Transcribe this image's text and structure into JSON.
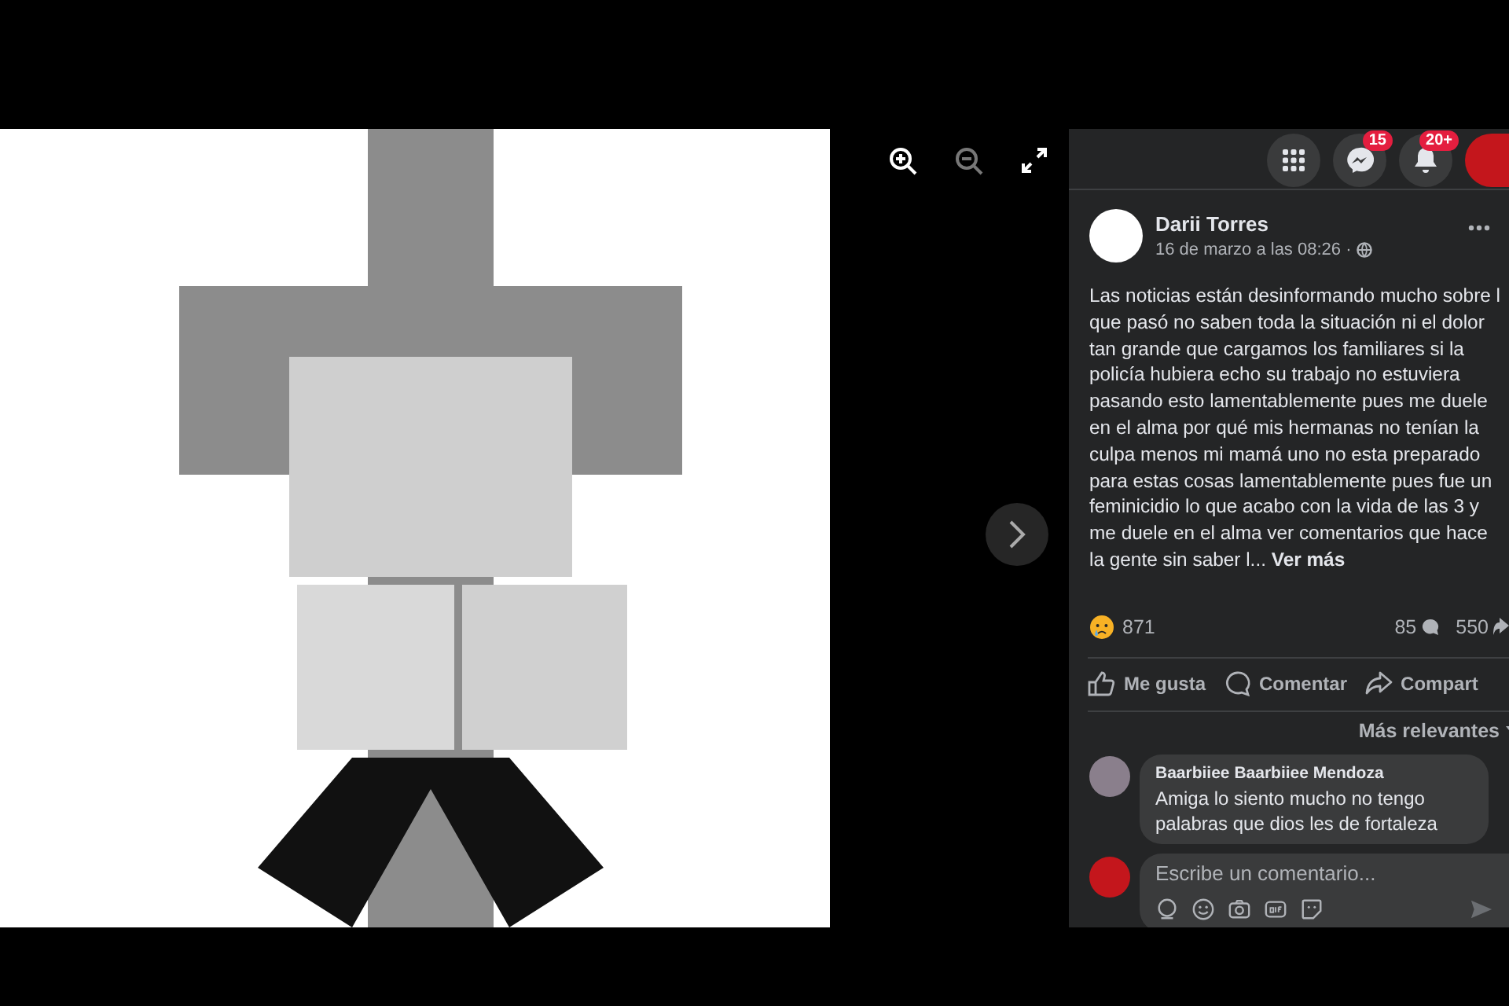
{
  "viewer": {
    "toolbar": [
      {
        "kind": "zoom-in",
        "disabled": false
      },
      {
        "kind": "zoom-out",
        "disabled": true
      },
      {
        "kind": "fullscreen",
        "disabled": false
      }
    ]
  },
  "top_nav": [
    {
      "kind": "menu"
    },
    {
      "kind": "messenger",
      "badge": "15"
    },
    {
      "kind": "notifications",
      "badge": "20+"
    },
    {
      "kind": "profile"
    }
  ],
  "post": {
    "author": "Darii Torres",
    "time": "16 de marzo a las 08:26 ·",
    "text": "Las noticias están desinformando mucho sobre l que pasó no saben toda la situación ni el dolor tan grande que cargamos los familiares si la policía hubiera echo su trabajo no estuviera pasando esto lamentablemente pues me duele en el alma por qué mis hermanas no tenían la culpa menos mi mamá uno no esta preparado para estas cosas lamentablemente pues fue un feminicidio lo que acabo con la vida de las 3 y me duele en el alma ver comentarios que hace la gente sin saber l...",
    "more": "Ver más",
    "reactions": "871",
    "comments_count": "85",
    "shares_count": "550"
  },
  "actions": [
    {
      "kind": "like",
      "label": "Me gusta"
    },
    {
      "kind": "comment",
      "label": "Comentar"
    },
    {
      "kind": "share",
      "label": "Compart"
    }
  ],
  "sort": "Más relevantes",
  "comments": [
    {
      "author": "Baarbiiee Baarbiiee Mendoza",
      "text": "Amiga lo siento mucho no tengo palabras que dios les de fortaleza"
    }
  ],
  "composer": {
    "placeholder": "Escribe un comentario..."
  }
}
